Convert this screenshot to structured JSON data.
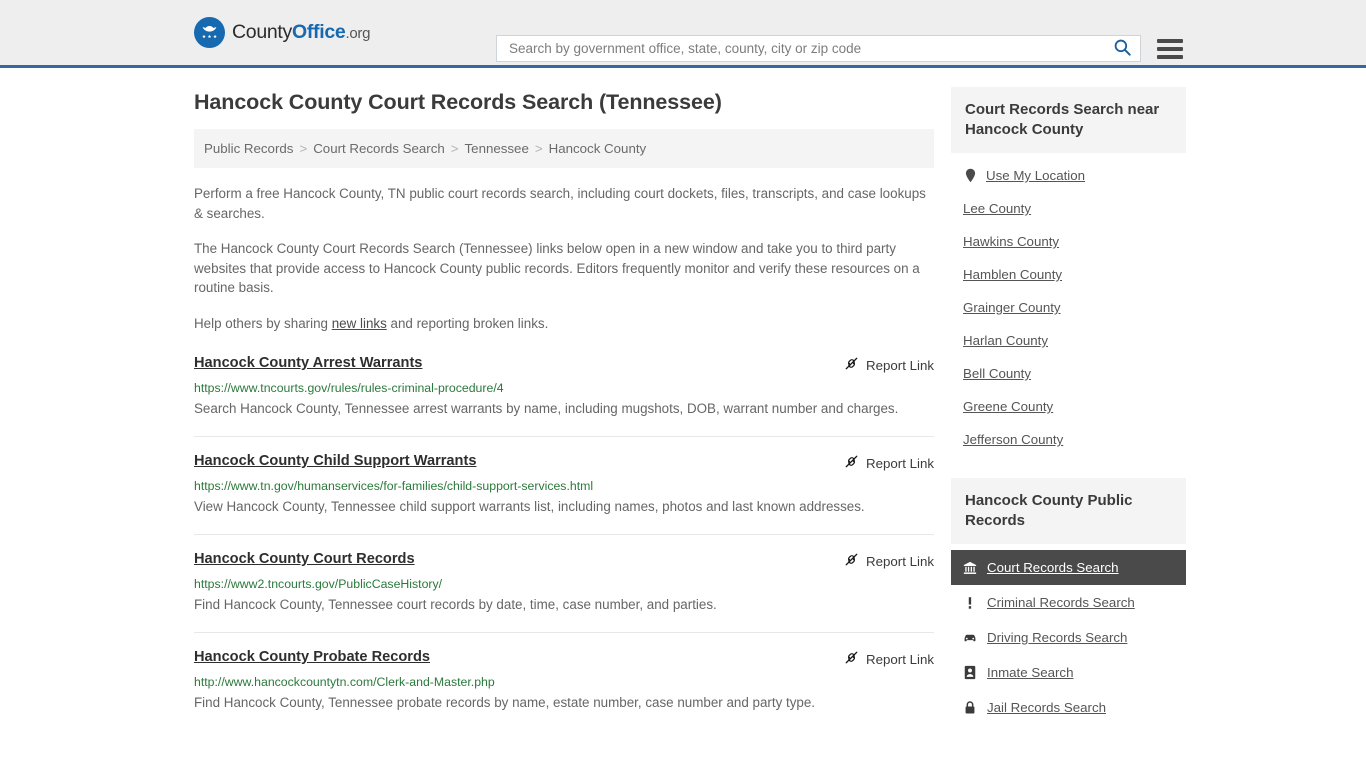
{
  "header": {
    "brand": {
      "part1": "County",
      "part2": "Office",
      "part3": ".org"
    },
    "search": {
      "placeholder": "Search by government office, state, county, city or zip code",
      "value": ""
    }
  },
  "page_title": "Hancock County Court Records Search (Tennessee)",
  "breadcrumb": {
    "items": [
      {
        "label": "Public Records",
        "current": false
      },
      {
        "label": "Court Records Search",
        "current": false
      },
      {
        "label": "Tennessee",
        "current": false
      },
      {
        "label": "Hancock County",
        "current": true
      }
    ],
    "separator": ">"
  },
  "intro": {
    "paragraph1": "Perform a free Hancock County, TN public court records search, including court dockets, files, transcripts, and case lookups & searches.",
    "paragraph2": "The Hancock County Court Records Search (Tennessee) links below open in a new window and take you to third party websites that provide access to Hancock County public records. Editors frequently monitor and verify these resources on a routine basis.",
    "paragraph3_before": "Help others by sharing ",
    "paragraph3_link": "new links",
    "paragraph3_after": " and reporting broken links."
  },
  "results": {
    "report_label": "Report Link",
    "items": [
      {
        "title": "Hancock County Arrest Warrants",
        "url": "https://www.tncourts.gov/rules/rules-criminal-procedure/4",
        "description": "Search Hancock County, Tennessee arrest warrants by name, including mugshots, DOB, warrant number and charges."
      },
      {
        "title": "Hancock County Child Support Warrants",
        "url": "https://www.tn.gov/humanservices/for-families/child-support-services.html",
        "description": "View Hancock County, Tennessee child support warrants list, including names, photos and last known addresses."
      },
      {
        "title": "Hancock County Court Records",
        "url": "https://www2.tncourts.gov/PublicCaseHistory/",
        "description": "Find Hancock County, Tennessee court records by date, time, case number, and parties."
      },
      {
        "title": "Hancock County Probate Records",
        "url": "http://www.hancockcountytn.com/Clerk-and-Master.php",
        "description": "Find Hancock County, Tennessee probate records by name, estate number, case number and party type."
      }
    ]
  },
  "sidebar": {
    "nearby": {
      "heading": "Court Records Search near Hancock County",
      "use_my_location": "Use My Location",
      "counties": [
        "Lee County",
        "Hawkins County",
        "Hamblen County",
        "Grainger County",
        "Harlan County",
        "Bell County",
        "Greene County",
        "Jefferson County"
      ]
    },
    "public_records": {
      "heading": "Hancock County Public Records",
      "items": [
        {
          "label": "Court Records Search",
          "icon": "bank-icon",
          "active": true
        },
        {
          "label": "Criminal Records Search",
          "icon": "exclamation-icon",
          "active": false
        },
        {
          "label": "Driving Records Search",
          "icon": "car-icon",
          "active": false
        },
        {
          "label": "Inmate Search",
          "icon": "id-badge-icon",
          "active": false
        },
        {
          "label": "Jail Records Search",
          "icon": "lock-icon",
          "active": false
        }
      ]
    }
  },
  "colors": {
    "brand_blue": "#1769b0",
    "header_border": "#33699e",
    "url_green": "#2a7a3b",
    "active_bg": "#4a4a4a",
    "panel_bg": "#f4f4f4"
  }
}
